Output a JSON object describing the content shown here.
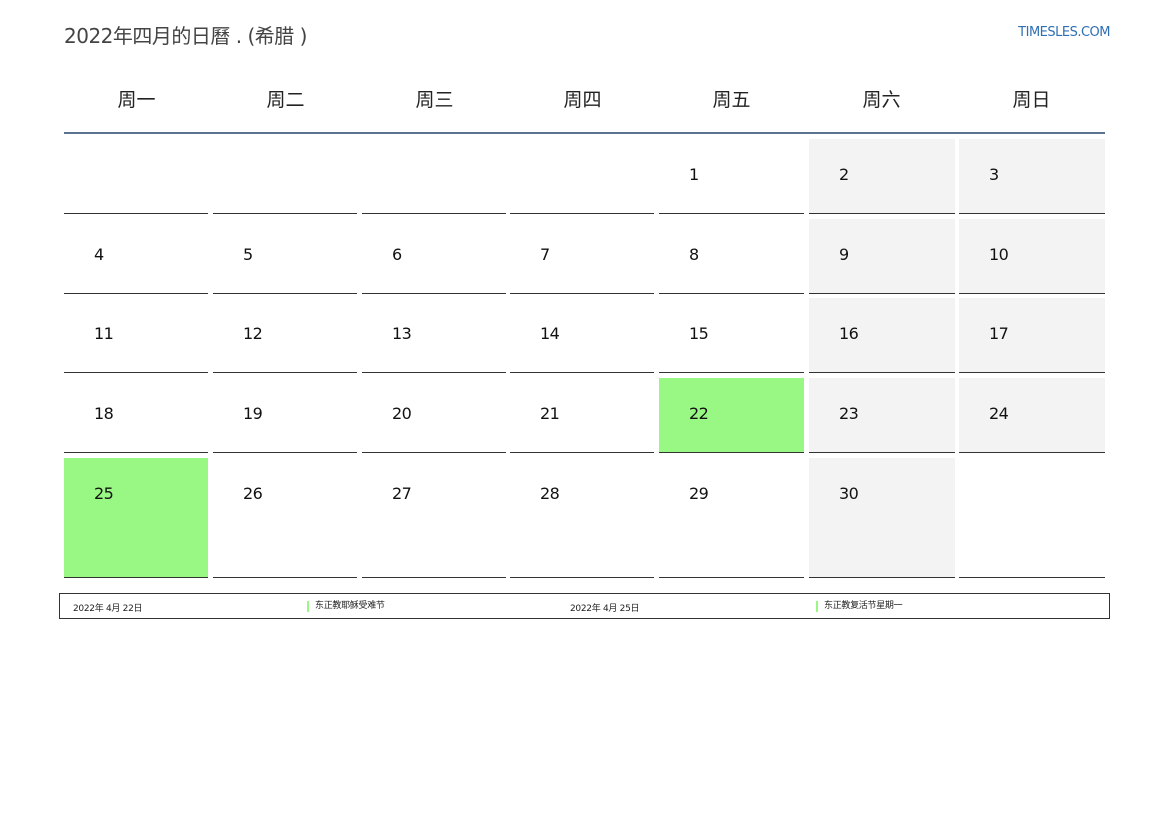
{
  "header": {
    "title": "2022年四月的日曆 . (希腊 )",
    "site": "TIMESLES.COM"
  },
  "weekdays": [
    "周一",
    "周二",
    "周三",
    "周四",
    "周五",
    "周六",
    "周日"
  ],
  "colors": {
    "holiday": "#99f884",
    "weekend": "#f3f3f3",
    "header_rule": "#5b7290",
    "site_link": "#2f6fb3"
  },
  "days": [
    {
      "label": "1"
    },
    {
      "label": "2"
    },
    {
      "label": "3"
    },
    {
      "label": "4"
    },
    {
      "label": "5"
    },
    {
      "label": "6"
    },
    {
      "label": "7"
    },
    {
      "label": "8"
    },
    {
      "label": "9"
    },
    {
      "label": "10"
    },
    {
      "label": "11"
    },
    {
      "label": "12"
    },
    {
      "label": "13"
    },
    {
      "label": "14"
    },
    {
      "label": "15"
    },
    {
      "label": "16"
    },
    {
      "label": "17"
    },
    {
      "label": "18"
    },
    {
      "label": "19"
    },
    {
      "label": "20"
    },
    {
      "label": "21"
    },
    {
      "label": "22"
    },
    {
      "label": "23"
    },
    {
      "label": "24"
    },
    {
      "label": "25"
    },
    {
      "label": "26"
    },
    {
      "label": "27"
    },
    {
      "label": "28"
    },
    {
      "label": "29"
    },
    {
      "label": "30"
    }
  ],
  "holidays": [
    {
      "date": "2022年 4月 22日",
      "name": "东正教耶稣受难节"
    },
    {
      "date": "2022年 4月 25日",
      "name": "东正教复活节星期一"
    }
  ]
}
